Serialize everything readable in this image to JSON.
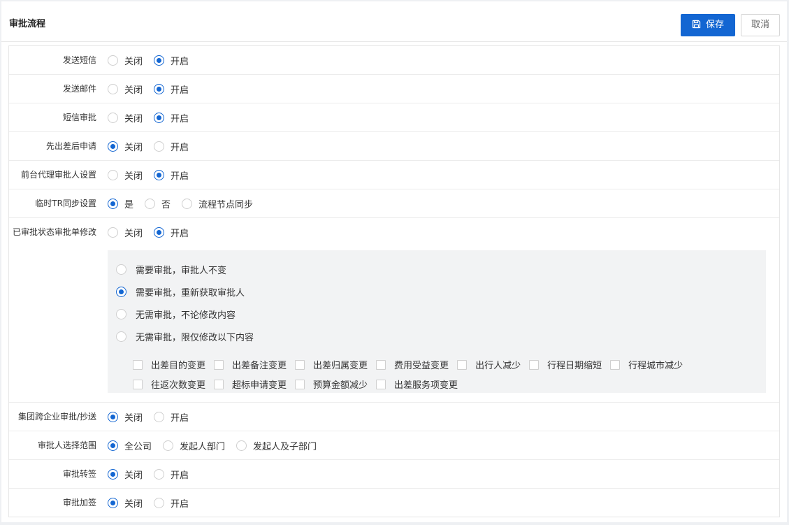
{
  "header": {
    "title": "审批流程",
    "save_label": "保存",
    "cancel_label": "取消"
  },
  "rows": [
    {
      "label": "发送短信",
      "options": [
        {
          "text": "关闭",
          "checked": false
        },
        {
          "text": "开启",
          "checked": true
        }
      ]
    },
    {
      "label": "发送邮件",
      "options": [
        {
          "text": "关闭",
          "checked": false
        },
        {
          "text": "开启",
          "checked": true
        }
      ]
    },
    {
      "label": "短信审批",
      "options": [
        {
          "text": "关闭",
          "checked": false
        },
        {
          "text": "开启",
          "checked": true
        }
      ]
    },
    {
      "label": "先出差后申请",
      "options": [
        {
          "text": "关闭",
          "checked": true
        },
        {
          "text": "开启",
          "checked": false
        }
      ]
    },
    {
      "label": "前台代理审批人设置",
      "options": [
        {
          "text": "关闭",
          "checked": false
        },
        {
          "text": "开启",
          "checked": true
        }
      ]
    },
    {
      "label": "临时TR同步设置",
      "options": [
        {
          "text": "是",
          "checked": true
        },
        {
          "text": "否",
          "checked": false
        },
        {
          "text": "流程节点同步",
          "checked": false
        }
      ]
    },
    {
      "label": "已审批状态审批单修改",
      "options": [
        {
          "text": "关闭",
          "checked": false
        },
        {
          "text": "开启",
          "checked": true
        }
      ]
    },
    {
      "label": "集团跨企业审批/抄送",
      "options": [
        {
          "text": "关闭",
          "checked": true
        },
        {
          "text": "开启",
          "checked": false
        }
      ]
    },
    {
      "label": "审批人选择范围",
      "options": [
        {
          "text": "全公司",
          "checked": true
        },
        {
          "text": "发起人部门",
          "checked": false
        },
        {
          "text": "发起人及子部门",
          "checked": false
        }
      ]
    },
    {
      "label": "审批转签",
      "options": [
        {
          "text": "关闭",
          "checked": true
        },
        {
          "text": "开启",
          "checked": false
        }
      ]
    },
    {
      "label": "审批加签",
      "options": [
        {
          "text": "关闭",
          "checked": true
        },
        {
          "text": "开启",
          "checked": false
        }
      ]
    }
  ],
  "modify_options": [
    {
      "text": "需要审批，审批人不变",
      "checked": false
    },
    {
      "text": "需要审批，重新获取审批人",
      "checked": true
    },
    {
      "text": "无需审批，不论修改内容",
      "checked": false
    },
    {
      "text": "无需审批，限仅修改以下内容",
      "checked": false
    }
  ],
  "modify_checkboxes": [
    [
      "出差目的变更",
      "出差备注变更",
      "出差归属变更",
      "费用受益变更",
      "出行人减少",
      "行程日期缩短",
      "行程城市减少"
    ],
    [
      "往返次数变更",
      "超标申请变更",
      "预算金额减少",
      "出差服务项变更"
    ]
  ],
  "colors": {
    "primary": "#1366d2",
    "sub_panel_bg": "#f2f3f4"
  },
  "icons": {
    "save": "save-icon"
  }
}
